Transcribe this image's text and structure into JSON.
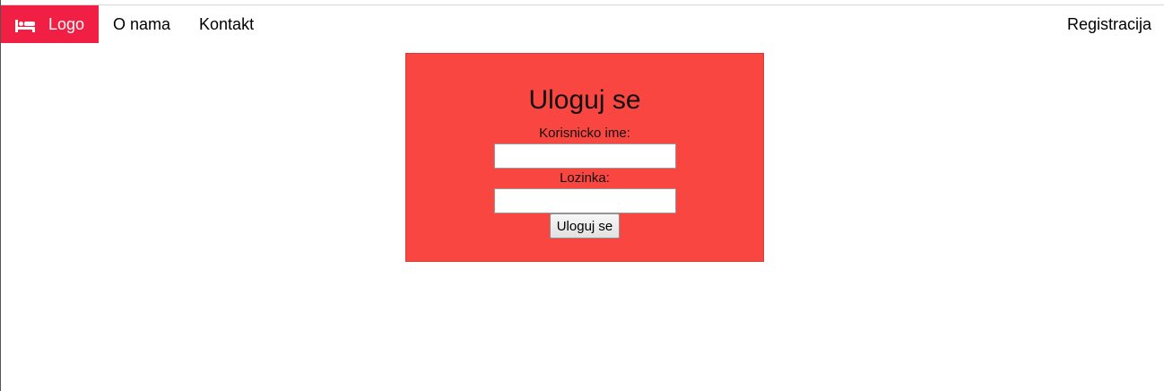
{
  "navbar": {
    "logo_icon": "bed-icon",
    "logo_label": "Logo",
    "links": [
      {
        "label": "O nama"
      },
      {
        "label": "Kontakt"
      }
    ],
    "right_link_label": "Registracija",
    "brand_color": "#f01f43"
  },
  "login": {
    "title": "Uloguj se",
    "username_label": "Korisnicko ime:",
    "username_value": "",
    "password_label": "Lozinka:",
    "password_value": "",
    "submit_label": "Uloguj se",
    "panel_color": "#f94641"
  }
}
